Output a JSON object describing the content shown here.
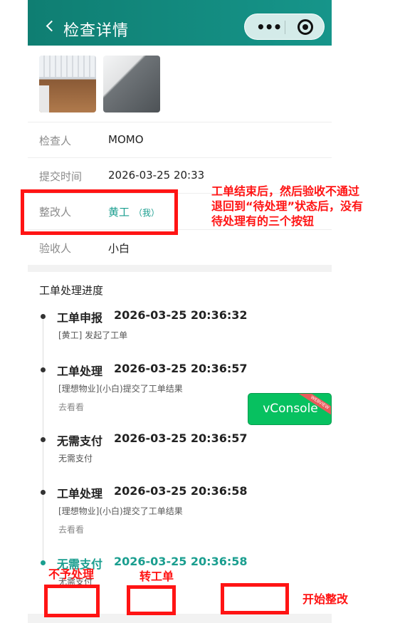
{
  "header": {
    "title": "检查详情"
  },
  "info": {
    "rows": [
      {
        "label": "检查人",
        "value": "MOMO"
      },
      {
        "label": "提交时间",
        "value": "2026-03-25 20:33"
      },
      {
        "label": "整改人",
        "value": "黄工",
        "tag": "（我）"
      },
      {
        "label": "验收人",
        "value": "小白"
      }
    ]
  },
  "progress": {
    "title": "工单处理进度",
    "items": [
      {
        "name": "工单申报",
        "time": "2026-03-25 20:36:32",
        "desc": "[黄工] 发起了工单"
      },
      {
        "name": "工单处理",
        "time": "2026-03-25 20:36:57",
        "desc": "[理想物业](小白)提交了工单结果",
        "link": "去看看"
      },
      {
        "name": "无需支付",
        "time": "2026-03-25 20:36:57",
        "desc": "无需支付"
      },
      {
        "name": "工单处理",
        "time": "2026-03-25 20:36:58",
        "desc": "[理想物业](小白)提交了工单结果",
        "link": "去看看"
      },
      {
        "name": "无需支付",
        "time": "2026-03-25 20:36:58",
        "desc": "无需支付"
      }
    ]
  },
  "vconsole": {
    "label": "vConsole",
    "ribbon": "WEBVIEW"
  },
  "annotations": {
    "note": "工单结束后，然后验收不通过退回到“待处理”状态后，没有待处理有的三个按钮",
    "note_lines": [
      "工单结束后，然后验收不通过",
      "退回到“待处理”状态后，没有",
      "待处理有的三个按钮"
    ],
    "btn1": "不予处理",
    "btn2": "转工单",
    "btn3": "开始整改"
  },
  "colors": {
    "header": "#128a7e",
    "accent": "#1a9e8f",
    "annotation": "#ff1414",
    "vconsole": "#07c160"
  }
}
